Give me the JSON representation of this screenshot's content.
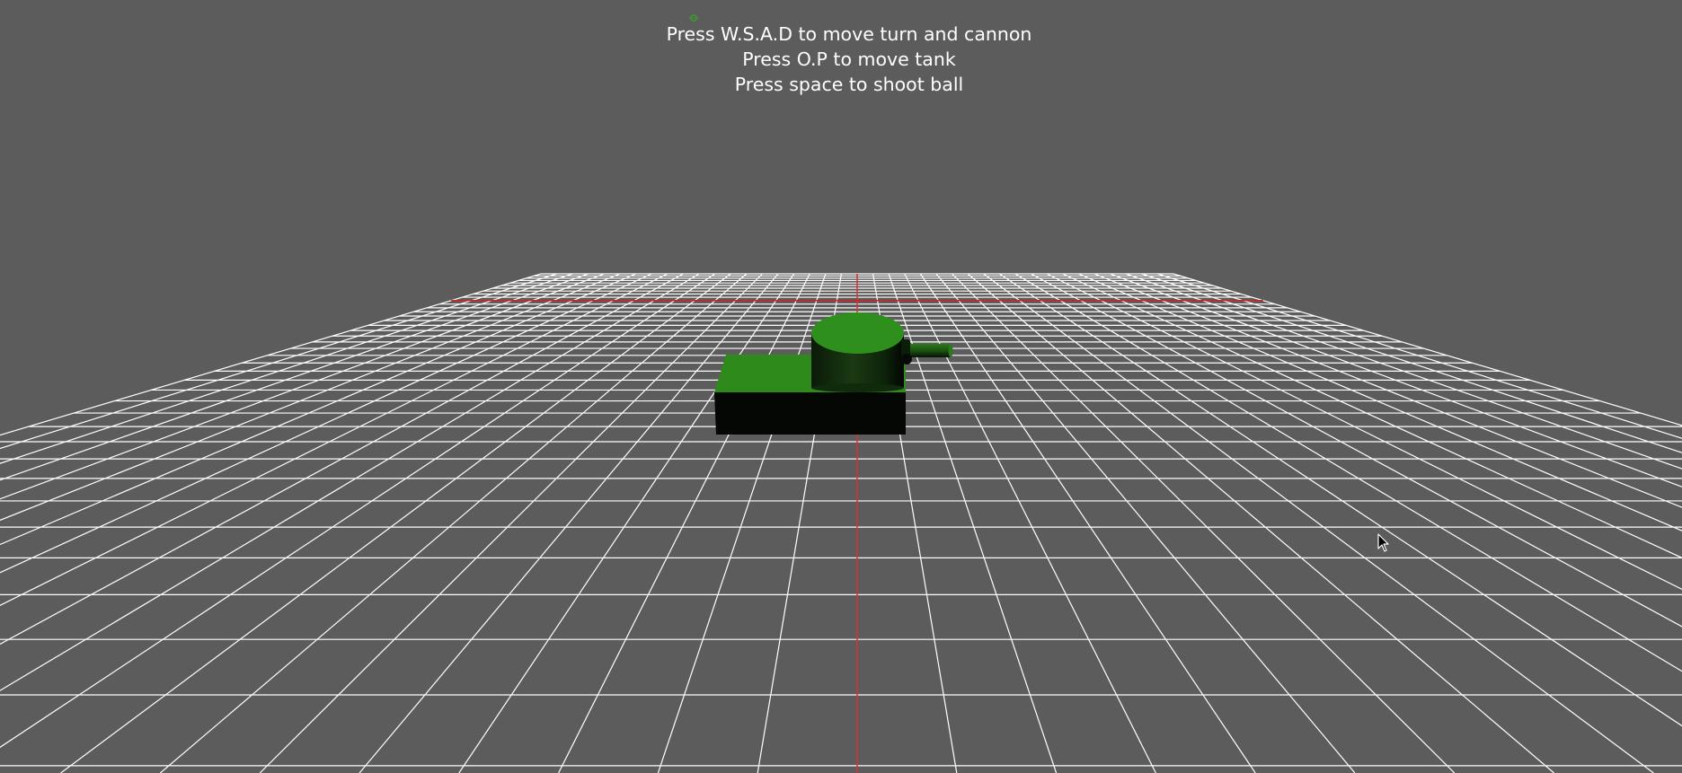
{
  "instructions": {
    "line1": "Press W.S.A.D to move turn and cannon",
    "line2": "Press O.P to move tank",
    "line3": "Press space to shoot ball"
  },
  "colors": {
    "background": "#5c5c5c",
    "grid_lines": "#ffffff",
    "axis_lines": "#d42020",
    "tank_top": "#2e8b1c",
    "tank_side": "#050805"
  },
  "icons": {
    "cursor": "arrow-cursor-icon",
    "marker": "small-green-marker-icon"
  }
}
